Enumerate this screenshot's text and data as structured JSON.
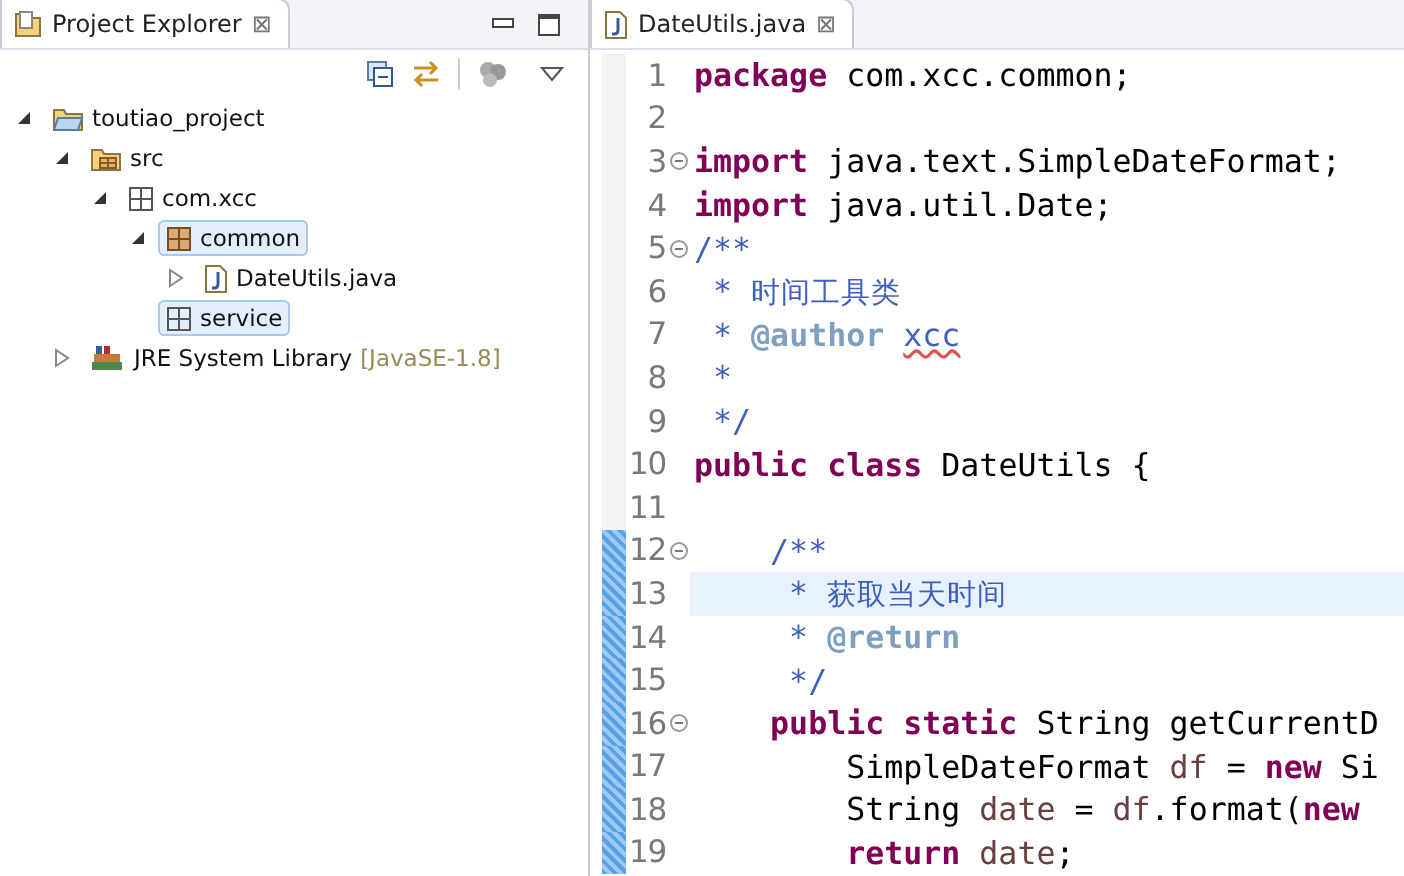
{
  "explorer": {
    "tab": {
      "label": "Project Explorer",
      "close": "⊠"
    },
    "tree": [
      {
        "label": "toutiao_project",
        "kind": "project",
        "expanded": true,
        "selected": false,
        "children": [
          {
            "label": "src",
            "kind": "source-folder",
            "expanded": true,
            "selected": false,
            "children": [
              {
                "label": "com.xcc",
                "kind": "package",
                "expanded": true,
                "selected": false,
                "children": [
                  {
                    "label": "common",
                    "kind": "package-filled",
                    "expanded": true,
                    "selected": true,
                    "children": [
                      {
                        "label": "DateUtils.java",
                        "kind": "java-file",
                        "expanded": false,
                        "selected": false
                      }
                    ]
                  },
                  {
                    "label": "service",
                    "kind": "package",
                    "selected": true
                  }
                ]
              }
            ]
          },
          {
            "label": "JRE System Library",
            "suffix": "[JavaSE-1.8]",
            "kind": "library",
            "expanded": false,
            "selected": false
          }
        ]
      }
    ]
  },
  "editor": {
    "tab": {
      "label": "DateUtils.java",
      "close": "⊠"
    },
    "lines": [
      {
        "number": "1",
        "fold": false,
        "changed": false,
        "current": false,
        "tokens": [
          {
            "kind": "keyword",
            "text": "package "
          },
          {
            "kind": "plain",
            "text": "com.xcc.common;"
          }
        ]
      },
      {
        "number": "2",
        "fold": false,
        "changed": false,
        "current": false
      },
      {
        "number": "3",
        "fold": true,
        "changed": false,
        "current": false,
        "tokens": [
          {
            "kind": "keyword",
            "text": "import "
          },
          {
            "kind": "plain",
            "text": "java.text.SimpleDateFormat;"
          }
        ]
      },
      {
        "number": "4",
        "fold": false,
        "changed": false,
        "current": false,
        "tokens": [
          {
            "kind": "keyword",
            "text": "import "
          },
          {
            "kind": "plain",
            "text": "java.util.Date;"
          }
        ]
      },
      {
        "number": "5",
        "fold": true,
        "changed": false,
        "current": false,
        "tokens": [
          {
            "kind": "comment",
            "text": "/**"
          }
        ]
      },
      {
        "number": "6",
        "fold": false,
        "changed": false,
        "current": false,
        "tokens": [
          {
            "kind": "comment",
            "text": " * 时间工具类"
          }
        ]
      },
      {
        "number": "7",
        "fold": false,
        "changed": false,
        "current": false,
        "tokens": [
          {
            "kind": "comment",
            "text": " * "
          },
          {
            "kind": "doctag",
            "text": "@author "
          },
          {
            "kind": "misspelled",
            "text": "xcc"
          }
        ]
      },
      {
        "number": "8",
        "fold": false,
        "changed": false,
        "current": false,
        "tokens": [
          {
            "kind": "comment",
            "text": " *"
          }
        ]
      },
      {
        "number": "9",
        "fold": false,
        "changed": false,
        "current": false,
        "tokens": [
          {
            "kind": "comment",
            "text": " */"
          }
        ]
      },
      {
        "number": "10",
        "fold": false,
        "changed": false,
        "current": false,
        "tokens": [
          {
            "kind": "keyword",
            "text": "public "
          },
          {
            "kind": "keyword",
            "text": "class "
          },
          {
            "kind": "plain",
            "text": "DateUtils {"
          }
        ]
      },
      {
        "number": "11",
        "fold": false,
        "changed": false,
        "current": false
      },
      {
        "number": "12",
        "fold": true,
        "changed": true,
        "current": false,
        "tokens": [
          {
            "kind": "comment",
            "text": "\t/**"
          }
        ]
      },
      {
        "number": "13",
        "fold": false,
        "changed": true,
        "current": true,
        "tokens": [
          {
            "kind": "comment",
            "text": "\t * 获取当天时间"
          }
        ]
      },
      {
        "number": "14",
        "fold": false,
        "changed": true,
        "current": false,
        "tokens": [
          {
            "kind": "comment",
            "text": "\t * "
          },
          {
            "kind": "doctag",
            "text": "@return"
          }
        ]
      },
      {
        "number": "15",
        "fold": false,
        "changed": true,
        "current": false,
        "tokens": [
          {
            "kind": "comment",
            "text": "\t */"
          }
        ]
      },
      {
        "number": "16",
        "fold": true,
        "changed": true,
        "current": false,
        "tokens": [
          {
            "kind": "keyword",
            "text": "\tpublic "
          },
          {
            "kind": "keyword",
            "text": "static "
          },
          {
            "kind": "plain",
            "text": "String getCurrentD"
          }
        ]
      },
      {
        "number": "17",
        "fold": false,
        "changed": true,
        "current": false,
        "tokens": [
          {
            "kind": "plain",
            "text": "\t\tSimpleDateFormat "
          },
          {
            "kind": "variable",
            "text": "df"
          },
          {
            "kind": "plain",
            "text": " = "
          },
          {
            "kind": "keyword",
            "text": "new "
          },
          {
            "kind": "plain",
            "text": "Si"
          }
        ]
      },
      {
        "number": "18",
        "fold": false,
        "changed": true,
        "current": false,
        "tokens": [
          {
            "kind": "plain",
            "text": "\t\tString "
          },
          {
            "kind": "variable",
            "text": "date"
          },
          {
            "kind": "plain",
            "text": " = "
          },
          {
            "kind": "variable",
            "text": "df"
          },
          {
            "kind": "plain",
            "text": ".format("
          },
          {
            "kind": "keyword",
            "text": "new"
          }
        ]
      },
      {
        "number": "19",
        "fold": false,
        "changed": true,
        "current": false,
        "tokens": [
          {
            "kind": "keyword",
            "text": "\t\treturn "
          },
          {
            "kind": "variable",
            "text": "date"
          },
          {
            "kind": "plain",
            "text": ";"
          }
        ]
      }
    ]
  }
}
